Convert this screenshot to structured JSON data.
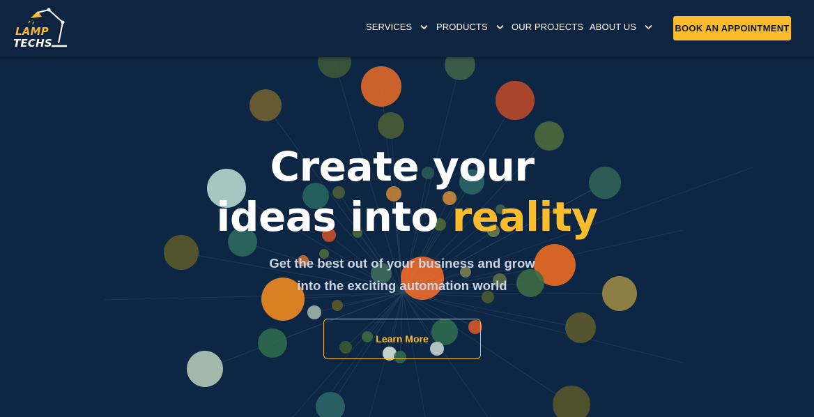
{
  "brand": {
    "line1": "LAMP",
    "line2": "TECHS",
    "accent_color": "#fbbc2b",
    "icon": "desk-lamp-icon"
  },
  "nav": {
    "items": [
      {
        "label": "SERVICES",
        "has_dropdown": true
      },
      {
        "label": "PRODUCTS",
        "has_dropdown": true
      },
      {
        "label": "OUR PROJECTS",
        "has_dropdown": false
      },
      {
        "label": "ABOUT US",
        "has_dropdown": true
      }
    ],
    "cta_label": "BOOK AN APPOINTMENT"
  },
  "hero": {
    "title_line1": "Create your",
    "title_line2_plain": "ideas into ",
    "title_line2_accent": "reality",
    "subtitle_line1": "Get the best out of your business and grow",
    "subtitle_line2": "into the exciting automation world",
    "button_label": "Learn More"
  },
  "colors": {
    "background": "#0d2644",
    "header": "#0e2440",
    "accent": "#fbbc2b",
    "text": "#ffffff"
  }
}
